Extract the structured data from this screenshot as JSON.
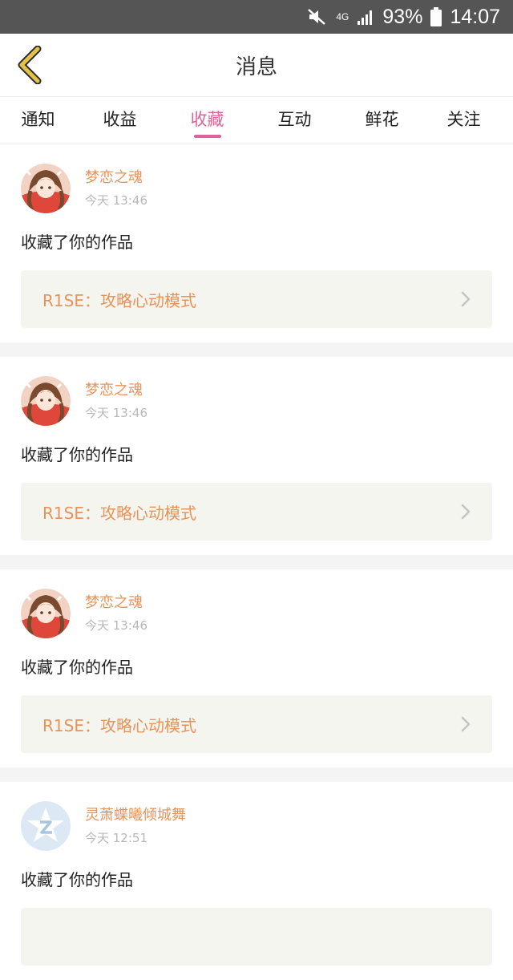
{
  "status_bar": {
    "network": "4G",
    "battery_percent": "93%",
    "time": "14:07",
    "icons": [
      "mute-icon",
      "network-arrows-icon",
      "signal-icon",
      "battery-icon"
    ]
  },
  "header": {
    "title": "消息",
    "back_icon": "chevron-left-icon"
  },
  "tabs": [
    {
      "label": "通知",
      "active": false
    },
    {
      "label": "收益",
      "active": false
    },
    {
      "label": "收藏",
      "active": true
    },
    {
      "label": "互动",
      "active": false
    },
    {
      "label": "鲜花",
      "active": false
    },
    {
      "label": "关注",
      "active": false
    }
  ],
  "colors": {
    "accent": "#e0629b",
    "name": "#e8935a",
    "muted": "#b8b8b8"
  },
  "messages": [
    {
      "username": "梦恋之魂",
      "time": "今天 13:46",
      "action": "收藏了你的作品",
      "work_title": "R1SE：攻略心动模式",
      "avatar": "anime-girl-avatar"
    },
    {
      "username": "梦恋之魂",
      "time": "今天 13:46",
      "action": "收藏了你的作品",
      "work_title": "R1SE：攻略心动模式",
      "avatar": "anime-girl-avatar"
    },
    {
      "username": "梦恋之魂",
      "time": "今天 13:46",
      "action": "收藏了你的作品",
      "work_title": "R1SE：攻略心动模式",
      "avatar": "anime-girl-avatar"
    },
    {
      "username": "灵萧蝶曦倾城舞",
      "time": "今天 12:51",
      "action": "收藏了你的作品",
      "work_title": "",
      "avatar": "default-star-avatar"
    }
  ]
}
